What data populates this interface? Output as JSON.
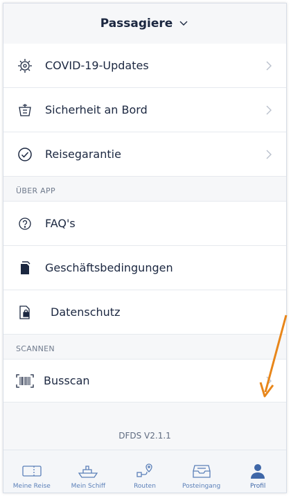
{
  "header": {
    "title": "Passagiere"
  },
  "rows": [
    {
      "label": "COVID-19-Updates",
      "icon": "virus-icon"
    },
    {
      "label": "Sicherheit an Bord",
      "icon": "safety-icon"
    },
    {
      "label": "Reisegarantie",
      "icon": "check-circle-icon"
    }
  ],
  "sections": {
    "about": "ÜBER APP",
    "scan": "SCANNEN"
  },
  "about_rows": [
    {
      "label": "FAQ's",
      "icon": "question-circle-icon"
    },
    {
      "label": "Geschäftsbedingungen",
      "icon": "document-icon"
    },
    {
      "label": "Datenschutz",
      "icon": "privacy-document-icon"
    }
  ],
  "scan_rows": [
    {
      "label": "Busscan",
      "icon": "barcode-icon"
    }
  ],
  "version": "DFDS V2.1.1",
  "tabs": [
    {
      "label": "Meine Reise",
      "icon": "ticket-icon"
    },
    {
      "label": "Mein Schiff",
      "icon": "ship-icon"
    },
    {
      "label": "Routen",
      "icon": "route-icon"
    },
    {
      "label": "Posteingang",
      "icon": "inbox-icon"
    },
    {
      "label": "Profil",
      "icon": "profile-icon"
    }
  ],
  "colors": {
    "accent": "#4a78c0",
    "annotation": "#e8861a"
  }
}
